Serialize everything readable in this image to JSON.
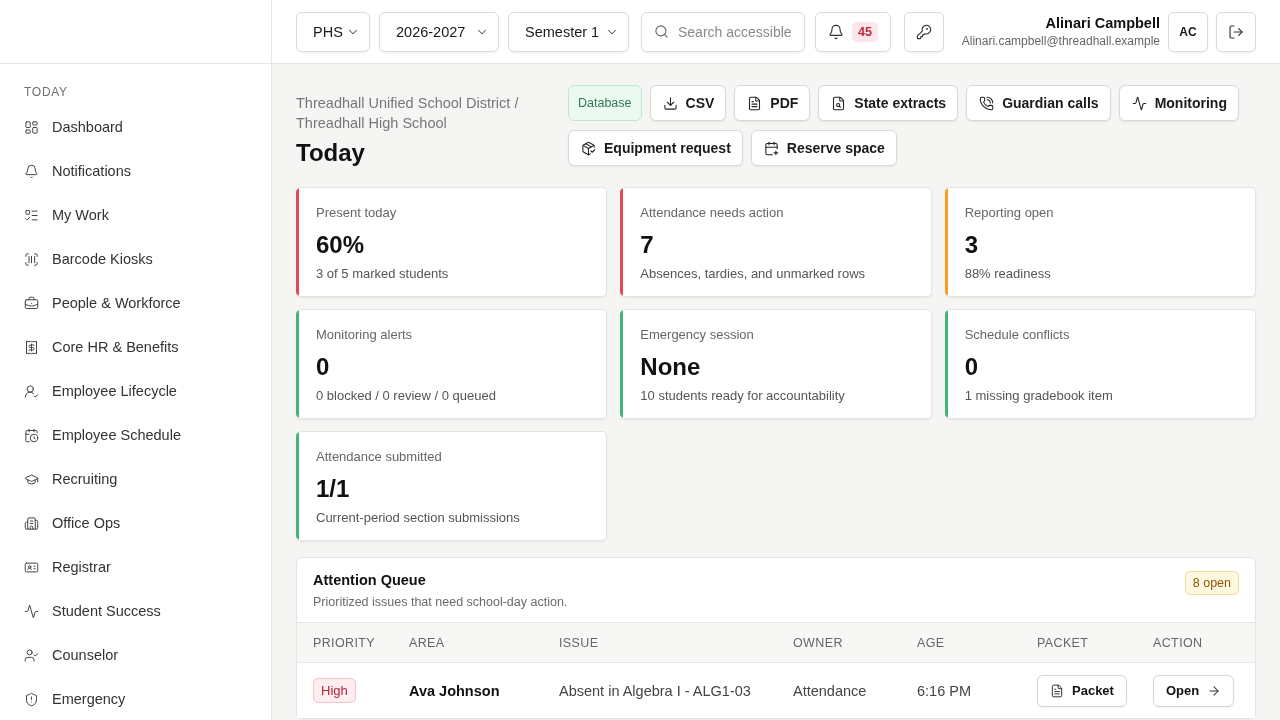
{
  "sidebar": {
    "section_label": "TODAY",
    "items": [
      {
        "label": "Dashboard"
      },
      {
        "label": "Notifications"
      },
      {
        "label": "My Work"
      },
      {
        "label": "Barcode Kiosks"
      },
      {
        "label": "People & Workforce"
      },
      {
        "label": "Core HR & Benefits"
      },
      {
        "label": "Employee Lifecycle"
      },
      {
        "label": "Employee Schedule"
      },
      {
        "label": "Recruiting"
      },
      {
        "label": "Office Ops"
      },
      {
        "label": "Registrar"
      },
      {
        "label": "Student Success"
      },
      {
        "label": "Counselor"
      },
      {
        "label": "Emergency"
      }
    ]
  },
  "top_bar": {
    "filters": [
      {
        "value": "PHS"
      },
      {
        "value": "2026-2027"
      },
      {
        "value": "Semester 1"
      }
    ],
    "search": {
      "placeholder": "Search accessible"
    },
    "notifications": {
      "count": "45"
    },
    "user": {
      "name": "Alinari Campbell",
      "email": "Alinari.campbell@threadhall.example",
      "initials": "AC"
    }
  },
  "page_header": {
    "breadcrumb": "Threadhall Unified School District / Threadhall High School",
    "title": "Today",
    "actions": [
      {
        "kind": "badge",
        "label": "Database"
      },
      {
        "kind": "button",
        "label": "CSV"
      },
      {
        "kind": "button",
        "label": "PDF"
      },
      {
        "kind": "button",
        "label": "State extracts"
      },
      {
        "kind": "button",
        "label": "Guardian calls"
      },
      {
        "kind": "button",
        "label": "Monitoring"
      },
      {
        "kind": "button",
        "label": "Equipment request"
      },
      {
        "kind": "button",
        "label": "Reserve space"
      }
    ]
  },
  "metrics": [
    {
      "label": "Present today",
      "value": "60%",
      "note": "3 of 5 marked students",
      "color": "#e5485b"
    },
    {
      "label": "Attendance needs action",
      "value": "7",
      "note": "Absences, tardies, and unmarked rows",
      "color": "#e5485b"
    },
    {
      "label": "Reporting open",
      "value": "3",
      "note": "88% readiness",
      "color": "#f0a01f"
    },
    {
      "label": "Monitoring alerts",
      "value": "0",
      "note": "0 blocked / 0 review / 0 queued",
      "color": "#46b37b"
    },
    {
      "label": "Emergency session",
      "value": "None",
      "note": "10 students ready for accountability",
      "color": "#46b37b"
    },
    {
      "label": "Schedule conflicts",
      "value": "0",
      "note": "1 missing gradebook item",
      "color": "#46b37b"
    },
    {
      "label": "Attendance submitted",
      "value": "1/1",
      "note": "Current-period section submissions",
      "color": "#46b37b"
    }
  ],
  "attention_queue": {
    "title": "Attention Queue",
    "subtitle": "Prioritized issues that need school-day action.",
    "badge": "8 open",
    "columns": [
      "PRIORITY",
      "AREA",
      "ISSUE",
      "OWNER",
      "AGE",
      "PACKET",
      "ACTION"
    ],
    "rows": [
      {
        "priority": {
          "label": "High",
          "kind": "high"
        },
        "area": "Ava Johnson",
        "issue": "Absent in Algebra I - ALG1-03",
        "owner": "Attendance",
        "age": "6:16 PM",
        "packet": "Packet",
        "action": "Open"
      }
    ]
  }
}
